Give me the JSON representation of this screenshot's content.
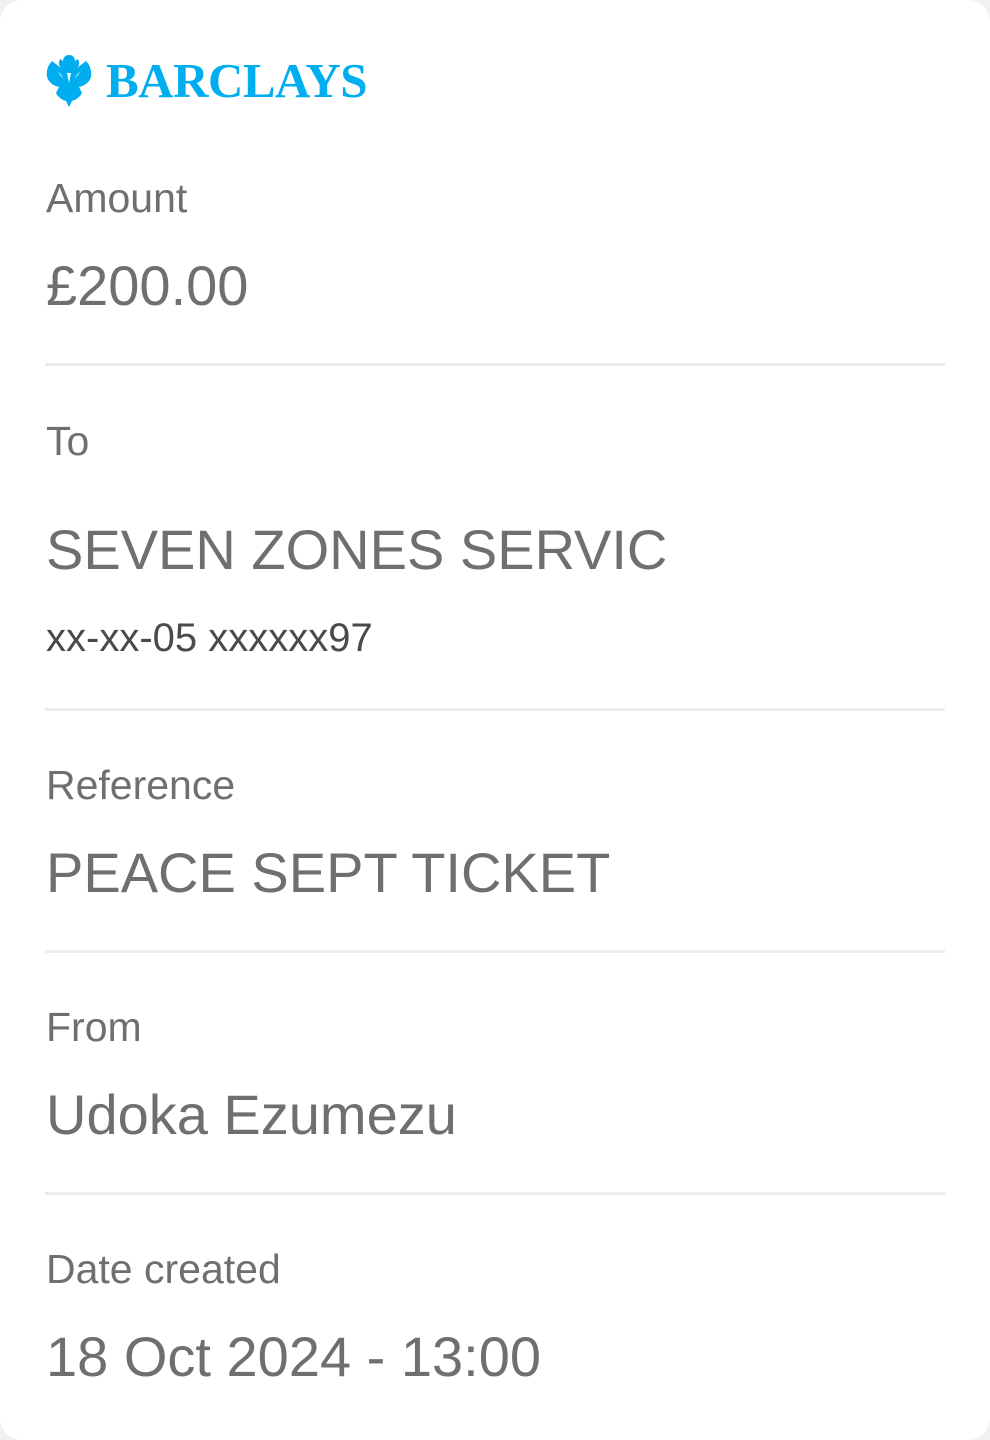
{
  "brand": {
    "name": "BARCLAYS",
    "icon": "eagle-icon",
    "color": "#00aeef"
  },
  "details": {
    "amount": {
      "label": "Amount",
      "value": "£200.00"
    },
    "to": {
      "label": "To",
      "value": "SEVEN ZONES SERVIC",
      "account": "xx-xx-05 xxxxxx97"
    },
    "reference": {
      "label": "Reference",
      "value": "PEACE SEPT TICKET"
    },
    "from": {
      "label": "From",
      "value": "Udoka Ezumezu"
    },
    "date_created": {
      "label": "Date created",
      "value": "18 Oct 2024 - 13:00"
    }
  },
  "colors": {
    "text": "#6f6f6f",
    "subtext": "#4a4a4a",
    "divider": "#ececec",
    "background": "#ffffff"
  }
}
